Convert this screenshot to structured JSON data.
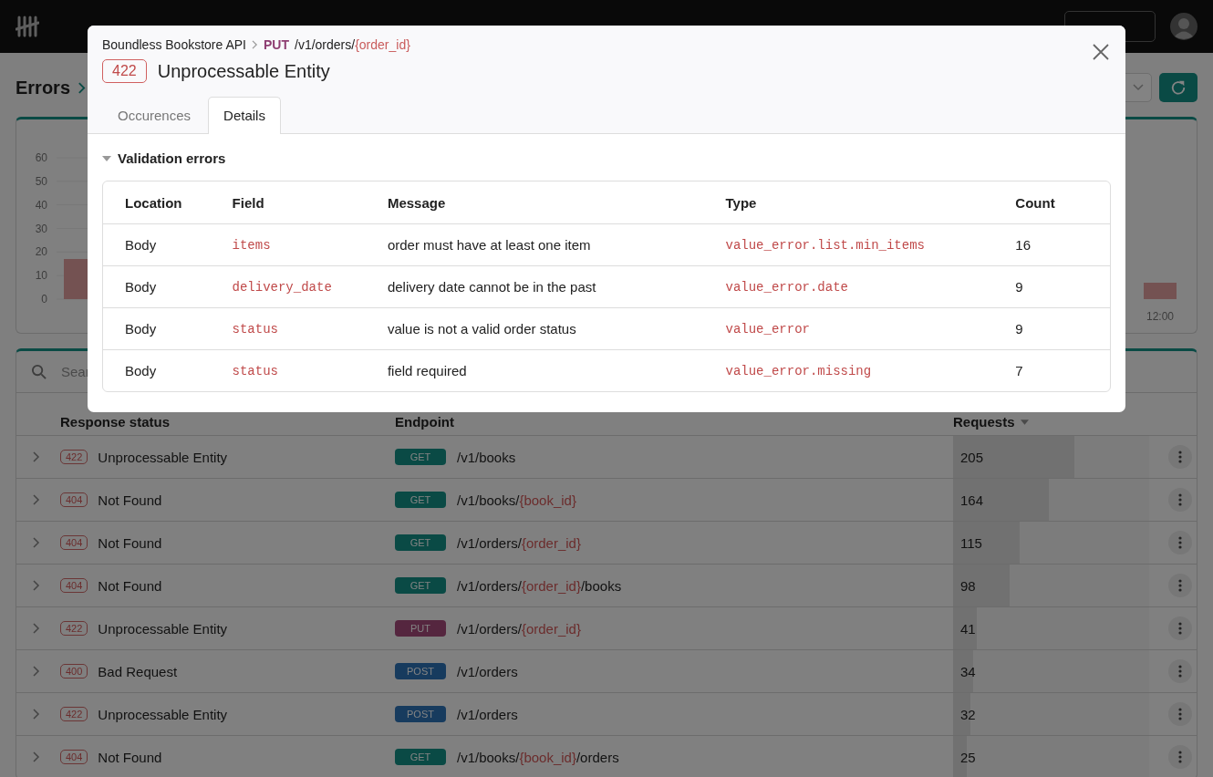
{
  "page": {
    "title": "Errors"
  },
  "chart": {
    "y_axis_labels": [
      "60",
      "50",
      "40",
      "30",
      "20",
      "10",
      "0"
    ],
    "x_axis_labels": [
      "12:00"
    ]
  },
  "errors_table": {
    "search_placeholder": "Sear",
    "columns": [
      "Response status",
      "Endpoint",
      "Requests"
    ],
    "rows": [
      {
        "code": "422",
        "status": "Unprocessable Entity",
        "method": {
          "label": "GET",
          "color": "#0a4a45"
        },
        "path": [
          {
            "text": "/v1/books",
            "param": false
          }
        ],
        "requests": "205",
        "level": 0.62
      },
      {
        "code": "404",
        "status": "Not Found",
        "method": {
          "label": "GET",
          "color": "#0a4a45"
        },
        "path": [
          {
            "text": "/v1/books/",
            "param": false
          },
          {
            "text": "{book_id}",
            "param": true
          }
        ],
        "requests": "164",
        "level": 0.49
      },
      {
        "code": "404",
        "status": "Not Found",
        "method": {
          "label": "GET",
          "color": "#0a4a45"
        },
        "path": [
          {
            "text": "/v1/orders/",
            "param": false
          },
          {
            "text": "{order_id}",
            "param": true
          }
        ],
        "requests": "115",
        "level": 0.34
      },
      {
        "code": "404",
        "status": "Not Found",
        "method": {
          "label": "GET",
          "color": "#0a4a45"
        },
        "path": [
          {
            "text": "/v1/orders/",
            "param": false
          },
          {
            "text": "{order_id}",
            "param": true
          },
          {
            "text": "/books",
            "param": false
          }
        ],
        "requests": "98",
        "level": 0.29
      },
      {
        "code": "422",
        "status": "Unprocessable Entity",
        "method": {
          "label": "PUT",
          "color": "#55263f"
        },
        "path": [
          {
            "text": "/v1/orders/",
            "param": false
          },
          {
            "text": "{order_id}",
            "param": true
          }
        ],
        "requests": "41",
        "level": 0.12
      },
      {
        "code": "400",
        "status": "Bad Request",
        "method": {
          "label": "POST",
          "color": "#173b5e"
        },
        "path": [
          {
            "text": "/v1/orders",
            "param": false
          }
        ],
        "requests": "34",
        "level": 0.1
      },
      {
        "code": "422",
        "status": "Unprocessable Entity",
        "method": {
          "label": "POST",
          "color": "#173b5e"
        },
        "path": [
          {
            "text": "/v1/orders",
            "param": false
          }
        ],
        "requests": "32",
        "level": 0.09
      },
      {
        "code": "404",
        "status": "Not Found",
        "method": {
          "label": "GET",
          "color": "#0a4a45"
        },
        "path": [
          {
            "text": "/v1/books/",
            "param": false
          },
          {
            "text": "{book_id}",
            "param": true
          },
          {
            "text": "/orders",
            "param": false
          }
        ],
        "requests": "25",
        "level": 0.07
      }
    ]
  },
  "modal": {
    "breadcrumb": {
      "api": "Boundless Bookstore API",
      "method": "PUT",
      "path": [
        {
          "text": "/v1/orders/",
          "param": false
        },
        {
          "text": "{order_id}",
          "param": true
        }
      ]
    },
    "code": "422",
    "title": "Unprocessable Entity",
    "tabs": [
      {
        "label": "Occurences",
        "selected": false
      },
      {
        "label": "Details",
        "selected": true
      }
    ],
    "section": {
      "title": "Validation errors",
      "expanded": true,
      "columns": [
        "Location",
        "Field",
        "Message",
        "Type",
        "Count"
      ],
      "rows": [
        {
          "location": "Body",
          "field": "items",
          "message": "order must have at least one item",
          "type": "value_error.list.min_items",
          "count": "16"
        },
        {
          "location": "Body",
          "field": "delivery_date",
          "message": "delivery date cannot be in the past",
          "type": "value_error.date",
          "count": "9"
        },
        {
          "location": "Body",
          "field": "status",
          "message": "value is not a valid order status",
          "type": "value_error",
          "count": "9"
        },
        {
          "location": "Body",
          "field": "status",
          "message": "field required",
          "type": "value_error.missing",
          "count": "7"
        }
      ]
    }
  }
}
